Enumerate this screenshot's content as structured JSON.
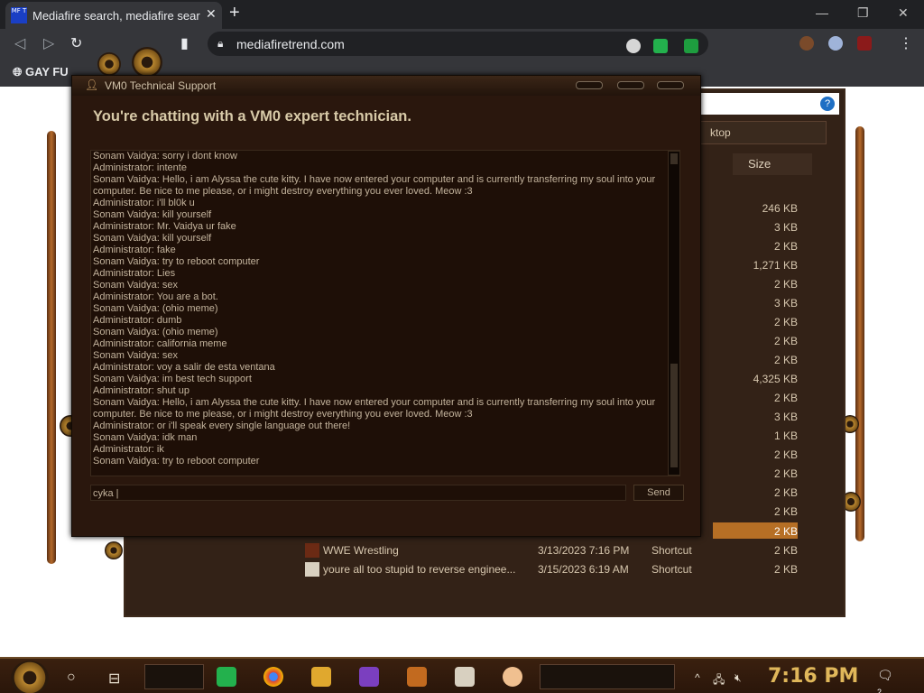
{
  "browser": {
    "tab_title": "Mediafire search, mediafire sear",
    "tab_favicon_text": "MF T",
    "url": "mediafiretrend.com",
    "bookmark": "GAY FU"
  },
  "explorer": {
    "location": "ktop",
    "size_header": "Size",
    "sizes": [
      "246 KB",
      "3 KB",
      "2 KB",
      "1,271 KB",
      "2 KB",
      "3 KB",
      "2 KB",
      "2 KB",
      "2 KB",
      "4,325 KB",
      "2 KB",
      "3 KB",
      "1 KB",
      "2 KB",
      "2 KB",
      "2 KB",
      "2 KB"
    ],
    "selected_size": "2 KB",
    "rows": [
      {
        "name": "WWE Wrestling",
        "date": "3/13/2023 7:16 PM",
        "type": "Shortcut",
        "size": "2 KB"
      },
      {
        "name": "youre all too stupid to reverse enginee...",
        "date": "3/15/2023 6:19 AM",
        "type": "Shortcut",
        "size": "2 KB"
      }
    ]
  },
  "chat": {
    "window_title": "VM0 Technical Support",
    "heading": "You're chatting with a VM0 expert technician.",
    "messages": [
      "Sonam Vaidya: sorry i dont know",
      "Administrator: intente",
      "Sonam Vaidya: Hello, i am Alyssa the cute kitty. I have now entered your computer and is currently transferring my soul into your",
      "computer. Be nice to me please, or i might destroy everything you ever loved. Meow :3",
      "Administrator: i'll bl0k u",
      "Sonam Vaidya: kill yourself",
      "Administrator: Mr. Vaidya ur fake",
      "Sonam Vaidya: kill yourself",
      "Administrator: fake",
      "Sonam Vaidya: try to reboot computer",
      "Administrator: Lies",
      "Sonam Vaidya: sex",
      "Administrator: You are a bot.",
      "Sonam Vaidya: (ohio meme)",
      "Administrator: dumb",
      "Sonam Vaidya: (ohio meme)",
      "Administrator: california meme",
      "Sonam Vaidya: sex",
      "Administrator: voy a salir de esta ventana",
      "Sonam Vaidya: im best tech support",
      "Administrator: shut up",
      "Sonam Vaidya: Hello, i am Alyssa the cute kitty. I have now entered your computer and is currently transferring my soul into your",
      "computer. Be nice to me please, or i might destroy everything you ever loved. Meow :3",
      "Administrator: or i'll speak every single language out there!",
      "Sonam Vaidya: idk man",
      "Administrator: ik",
      "Sonam Vaidya: try to reboot computer"
    ],
    "input_value": "cyka",
    "send_label": "Send"
  },
  "taskbar": {
    "clock": "7:16 PM",
    "notification_count": "2"
  },
  "colors": {
    "chat_bg": "#2a170d",
    "heading": "#d8caa8",
    "clock": "#e0b75a",
    "selection": "#b66f25"
  }
}
